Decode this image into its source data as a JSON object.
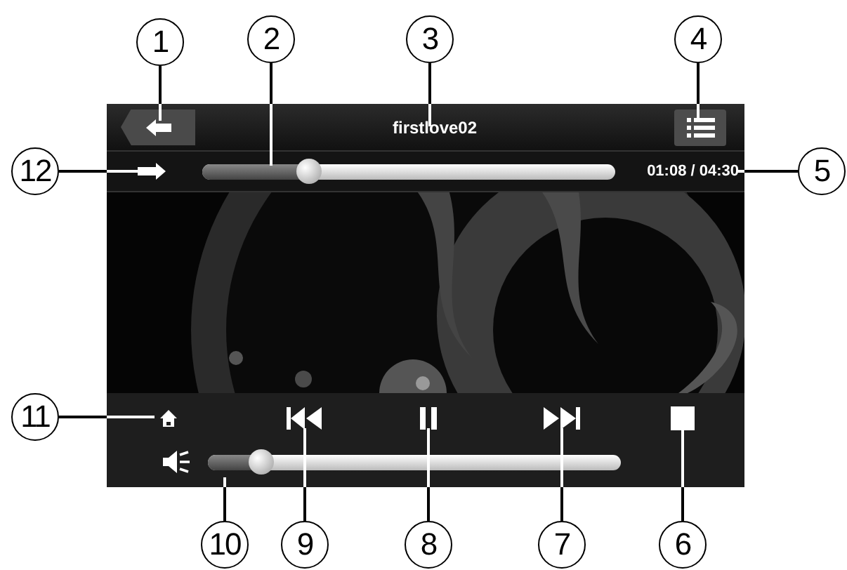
{
  "player": {
    "title": "firstlove02",
    "progress": {
      "level": 0.26,
      "time": "01:08 / 04:30"
    },
    "controls": [
      {
        "kind": "home"
      },
      {
        "kind": "previous"
      },
      {
        "kind": "pause"
      },
      {
        "kind": "next"
      },
      {
        "kind": "stop"
      }
    ],
    "volume": {
      "level": 0.13
    }
  },
  "callouts": [
    "1",
    "2",
    "3",
    "4",
    "12",
    "5",
    "11",
    "10",
    "9",
    "8",
    "7",
    "6"
  ]
}
